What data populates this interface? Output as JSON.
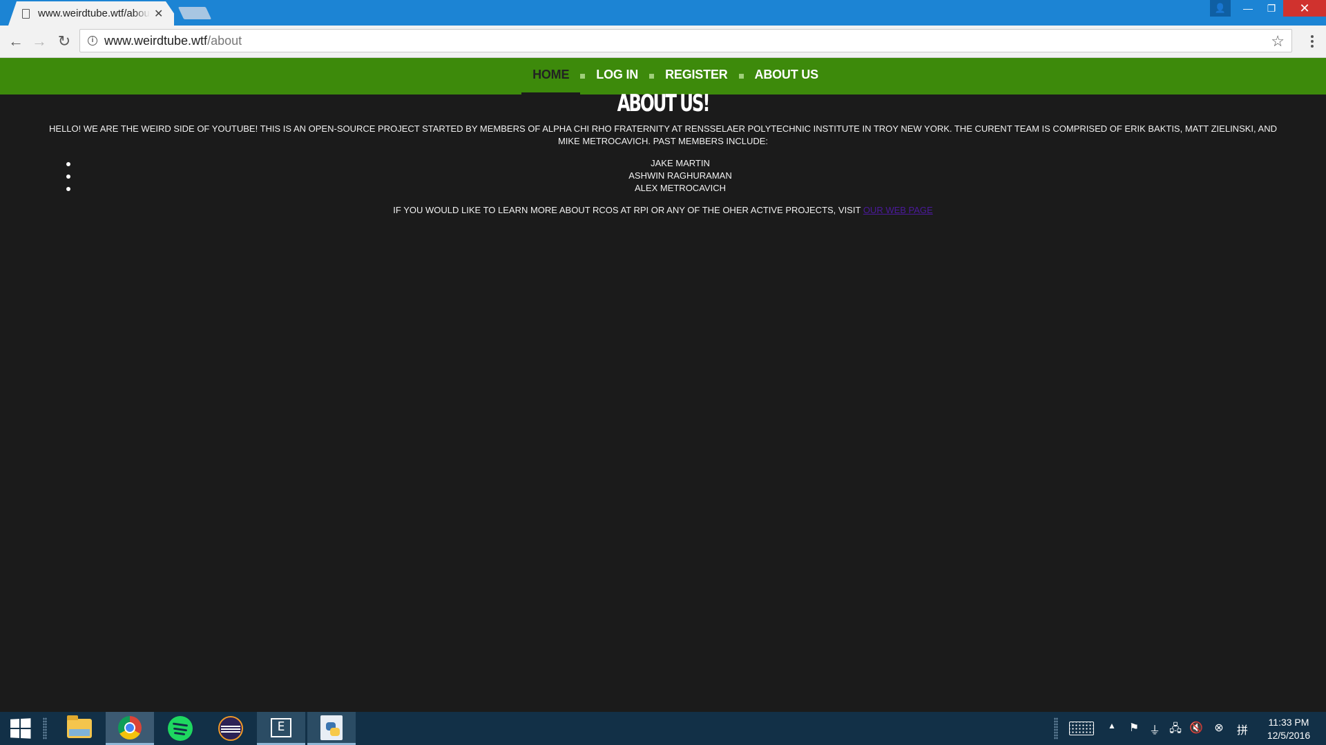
{
  "browser": {
    "tab_title": "www.weirdtube.wtf/about",
    "url_host": "www.weirdtube.wtf",
    "url_path": "/about"
  },
  "site_nav": {
    "items": [
      {
        "label": "HOME",
        "active": true
      },
      {
        "label": "LOG IN",
        "active": false
      },
      {
        "label": "REGISTER",
        "active": false
      },
      {
        "label": "ABOUT US",
        "active": false
      }
    ]
  },
  "content": {
    "title": "ABOUT US!",
    "intro": "HELLO! WE ARE THE WEIRD SIDE OF YOUTUBE! THIS IS AN OPEN-SOURCE PROJECT STARTED BY MEMBERS OF ALPHA CHI RHO FRATERNITY AT RENSSELAER POLYTECHNIC INSTITUTE IN TROY NEW YORK. THE CURENT TEAM IS COMPRISED OF ERIK BAKTIS, MATT ZIELINSKI, AND MIKE METROCAVICH. PAST MEMBERS INCLUDE:",
    "past_members": [
      "JAKE MARTIN",
      "ASHWIN RAGHURAMAN",
      "ALEX METROCAVICH"
    ],
    "outro_text": "IF YOU WOULD LIKE TO LEARN MORE ABOUT RCOS AT RPI OR ANY OF THE OHER ACTIVE PROJECTS, VISIT",
    "outro_link": "OUR WEB PAGE"
  },
  "taskbar": {
    "apps": [
      "file-explorer",
      "chrome",
      "spotify",
      "eclipse",
      "terminal",
      "python"
    ],
    "time": "11:33 PM",
    "date": "12/5/2016"
  },
  "colors": {
    "nav_green": "#3d8a0b",
    "page_bg": "#1b1b1b",
    "link_purple": "#4b1a9c",
    "titlebar_blue": "#1c84d4",
    "taskbar": "#123047"
  }
}
